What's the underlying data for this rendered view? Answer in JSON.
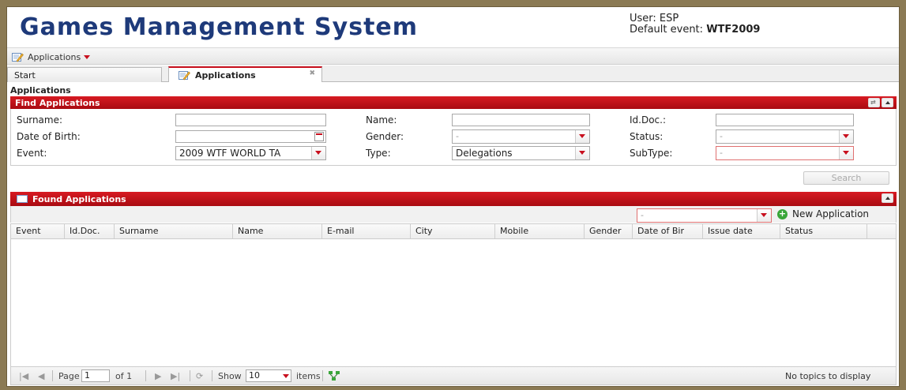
{
  "header": {
    "title": "Games Management System",
    "user_label": "User: ESP",
    "event_label": "Default event:",
    "event_value": "WTF2009"
  },
  "menu": {
    "applications_label": "Applications"
  },
  "tabs": {
    "start": "Start",
    "applications": "Applications"
  },
  "page_title": "Applications",
  "find": {
    "panel_title": "Find Applications",
    "surname_label": "Surname:",
    "surname_value": "",
    "name_label": "Name:",
    "name_value": "",
    "iddoc_label": "Id.Doc.:",
    "iddoc_value": "",
    "dob_label": "Date of Birth:",
    "dob_value": "",
    "gender_label": "Gender:",
    "gender_value": "-",
    "status_label": "Status:",
    "status_value": "-",
    "event_label": "Event:",
    "event_value": "2009 WTF WORLD TA",
    "type_label": "Type:",
    "type_value": "Delegations",
    "subtype_label": "SubType:",
    "subtype_value": "-",
    "search_label": "Search"
  },
  "found": {
    "panel_title": "Found Applications",
    "filter_value": "-",
    "new_app_label": "New Application",
    "columns": [
      "Event",
      "Id.Doc.",
      "Surname",
      "Name",
      "E-mail",
      "City",
      "Mobile",
      "Gender",
      "Date of Bir",
      "Issue date",
      "Status"
    ]
  },
  "pager": {
    "page_label": "Page",
    "page_value": "1",
    "of_label": "of 1",
    "show_label": "Show",
    "show_value": "10",
    "items_label": "items",
    "status": "No topics to display"
  }
}
